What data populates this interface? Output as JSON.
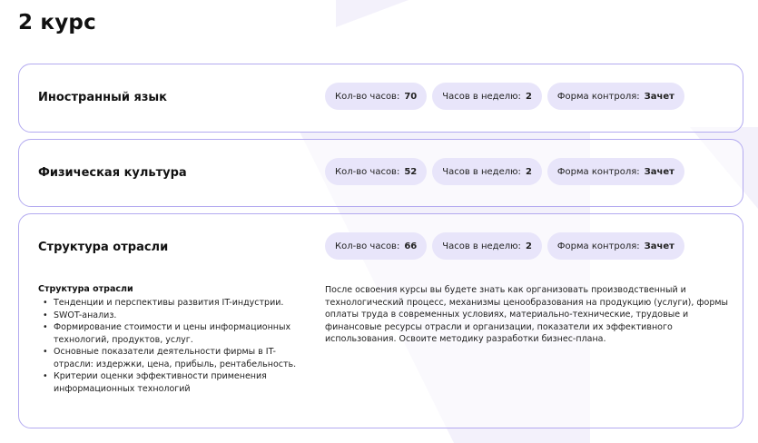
{
  "page": {
    "title": "2 курс"
  },
  "labels": {
    "hours": "Кол-во часов:",
    "per_week": "Часов в неделю:",
    "control": "Форма контроля:"
  },
  "courses": [
    {
      "name": "Иностранный язык",
      "hours": "70",
      "per_week": "2",
      "control": "Зачет"
    },
    {
      "name": "Физическая культура",
      "hours": "52",
      "per_week": "2",
      "control": "Зачет"
    },
    {
      "name": "Структура отрасли",
      "hours": "66",
      "per_week": "2",
      "control": "Зачет",
      "topic_title": "Структура отрасли",
      "topics": [
        "Тенденции и перспективы развития IT-индустрии.",
        "SWOT-анализ.",
        "Формирование стоимости и цены информационных технологий, продуктов, услуг.",
        "Основные показатели деятельности фирмы в IT-отрасли: издержки, цена, прибыль, рентабельность.",
        "Критерии оценки эффективности применения информационных технологий"
      ],
      "description": "После освоения курсы вы будете знать как организовать производственный и технологический процесс, механизмы ценообразования на продукцию (услуги), формы оплаты труда в современных условиях, материально-технические, трудовые и финансовые ресурсы отрасли и организации, показатели их эффективного использования. Освоите методику разработки бизнес-плана."
    }
  ],
  "colors": {
    "accent_border": "#b3aaf0",
    "pill_bg": "#e8e5fa",
    "background_shape": "#f3f1fb"
  }
}
